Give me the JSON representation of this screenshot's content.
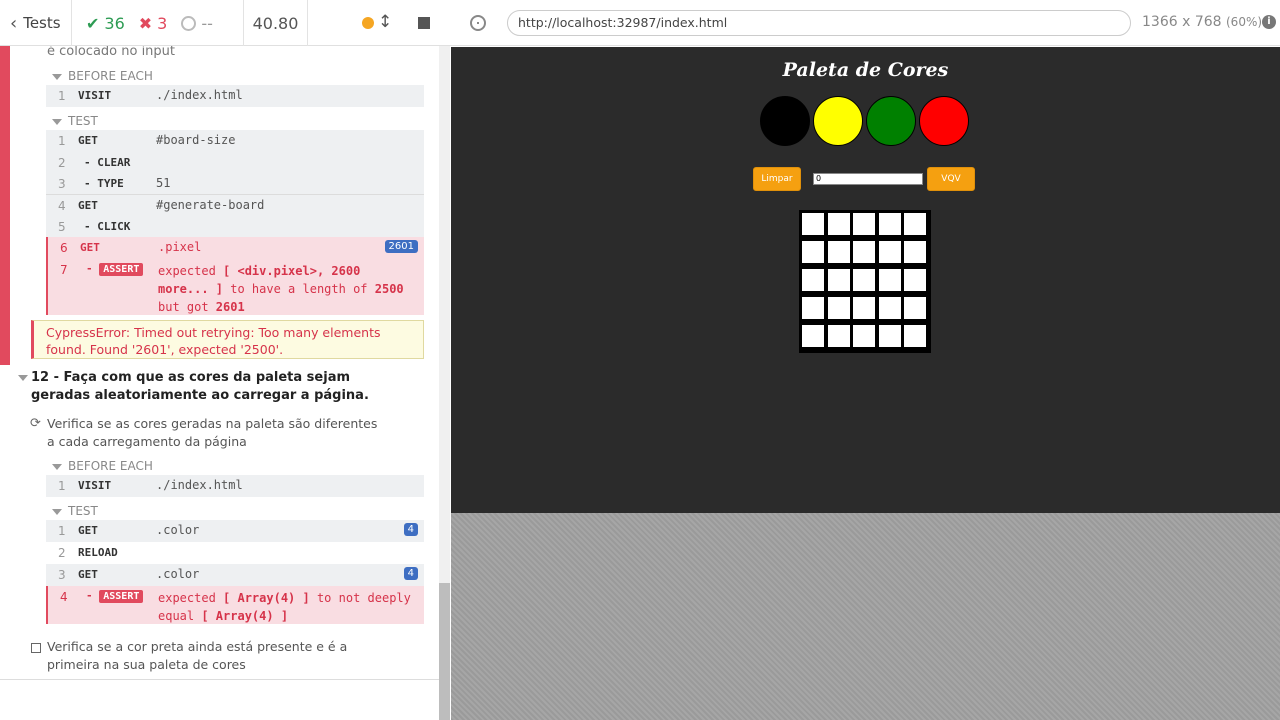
{
  "header": {
    "tests_label": "Tests",
    "passed": "36",
    "failed": "3",
    "pending": "--",
    "duration": "40.80"
  },
  "reporter": {
    "prev_test_tail": "é colocado no input",
    "before_each_1": "BEFORE EACH",
    "visit_1": {
      "num": "1",
      "name": "VISIT",
      "arg": "./index.html"
    },
    "test_hook_1": "TEST",
    "cmds_1": [
      {
        "num": "1",
        "name": "GET",
        "arg": "#board-size"
      },
      {
        "num": "2",
        "name": "- CLEAR",
        "arg": ""
      },
      {
        "num": "3",
        "name": "- TYPE",
        "arg": "51"
      },
      {
        "num": "4",
        "name": "GET",
        "arg": "#generate-board"
      },
      {
        "num": "5",
        "name": "- CLICK",
        "arg": ""
      }
    ],
    "failed_get": {
      "num": "6",
      "name": "GET",
      "arg": ".pixel",
      "badge": "2601"
    },
    "failed_assert": {
      "num": "7",
      "tag": "ASSERT",
      "line1_a": "expected ",
      "line1_b": "[ <div.pixel>, 2600",
      "line2_b": "more... ]",
      "line2_c": " to have a length of ",
      "line2_d": "2500",
      "line3_a": "but got ",
      "line3_b": "2601"
    },
    "error": "CypressError: Timed out retrying: Too many elements found. Found '2601', expected '2500'.",
    "test12_title": "12 - Faça com que as cores da paleta sejam geradas aleatoriamente ao carregar a página.",
    "test12_sub1": "Verifica se as cores geradas na paleta são diferentes a cada carregamento da página",
    "before_each_2": "BEFORE EACH",
    "visit_2": {
      "num": "1",
      "name": "VISIT",
      "arg": "./index.html"
    },
    "test_hook_2": "TEST",
    "cmds_2": [
      {
        "num": "1",
        "name": "GET",
        "arg": ".color",
        "badge": "4"
      },
      {
        "num": "2",
        "name": "RELOAD",
        "arg": ""
      },
      {
        "num": "3",
        "name": "GET",
        "arg": ".color",
        "badge": "4"
      }
    ],
    "assert2": {
      "num": "4",
      "tag": "ASSERT",
      "a": "expected ",
      "b": "[ Array(4) ]",
      "c": " to not deeply",
      "d": "equal ",
      "e": "[ Array(4) ]"
    },
    "test12_sub2": "Verifica se a cor preta ainda está presente e é a primeira na sua paleta de cores"
  },
  "aut": {
    "url": "http://localhost:32987/index.html",
    "viewport": "1366 x 768",
    "scale": "(60%)",
    "app_title": "Paleta de Cores",
    "palette": [
      "#000000",
      "#ffff00",
      "#008000",
      "#ff0000"
    ],
    "clear_button": "Limpar",
    "vqv_button": "VQV",
    "board_size_value": "0",
    "board_rows": 5,
    "board_cols": 5
  }
}
